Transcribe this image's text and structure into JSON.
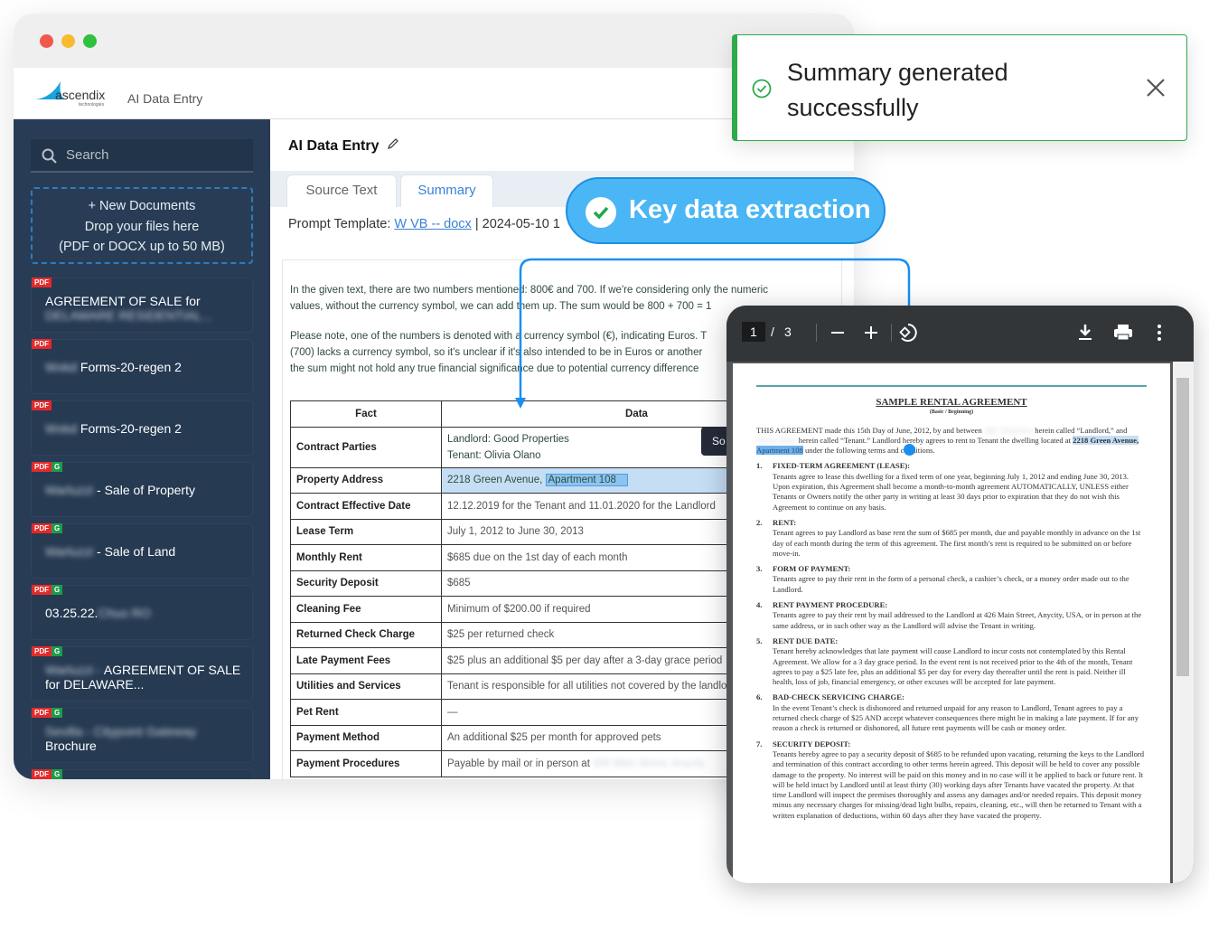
{
  "app": {
    "logo_text": "ascendix",
    "logo_sub": "technologies",
    "title": "AI Data Entry"
  },
  "sidebar": {
    "search_placeholder": "Search",
    "drop": {
      "line1": "+ New Documents",
      "line2": "Drop your files here",
      "line3": "(PDF or DOCX up to 50 MB)"
    },
    "documents": [
      {
        "badges": [
          "PDF"
        ],
        "title": "AGREEMENT OF SALE for",
        "blurred": "DELAWARE RESIDENTIAL..."
      },
      {
        "badges": [
          "PDF"
        ],
        "blurred": "Wxkd",
        "title": "Forms-20-regen 2"
      },
      {
        "badges": [
          "PDF"
        ],
        "blurred": "Wxkd",
        "title": "Forms-20-regen 2"
      },
      {
        "badges": [
          "PDF",
          "G"
        ],
        "blurred": "Warluzzi",
        "title": "- Sale of Property"
      },
      {
        "badges": [
          "PDF",
          "G"
        ],
        "blurred": "Warluzzi",
        "title": "- Sale of Land"
      },
      {
        "badges": [
          "PDF",
          "G"
        ],
        "title": "03.25.22.",
        "blurred": "Chuo RO"
      },
      {
        "badges": [
          "PDF",
          "G"
        ],
        "blurred": "Warluzzi -",
        "title": "AGREEMENT OF SALE for DELAWARE..."
      },
      {
        "badges": [
          "PDF",
          "G"
        ],
        "blurred": "Sevilla - Citypoint Gateway",
        "title": "Brochure"
      },
      {
        "badges": [
          "PDF",
          "G"
        ],
        "title": ""
      }
    ]
  },
  "main": {
    "page_title": "AI Data Entry",
    "tabs": [
      {
        "label": "Source Text"
      },
      {
        "label": "Summary",
        "active": true
      }
    ],
    "prompt": {
      "label": "Prompt Template:",
      "link": "W VB -- docx",
      "sep": "|",
      "date": "2024-05-10 1"
    },
    "paragraphs": [
      "In the given text, there are two numbers mentioned: 800€ and 700. If we're considering only the numeric",
      "values, without the currency symbol, we can add them up. The sum would be 800 + 700 = 1",
      "Please note, one of the numbers is denoted with a currency symbol (€), indicating Euros. T",
      "(700) lacks a currency symbol, so it's unclear if it's also intended to be in Euros or another",
      "the sum might not hold any true financial significance due to potential currency difference"
    ],
    "table": {
      "headers": [
        "Fact",
        "Data"
      ],
      "rows": [
        {
          "fact": "Contract Parties",
          "data": [
            "Landlord: Good Properties",
            "Tenant: Olivia Olano"
          ]
        },
        {
          "fact": "Property Address",
          "data": [
            "2218 Green Avenue,",
            "Apartment 108"
          ],
          "highlighted": true
        },
        {
          "fact": "Contract Effective Date",
          "data": [
            "12.12.2019 for the Tenant and 11.01.2020 for the Landlord"
          ]
        },
        {
          "fact": "Lease Term",
          "data": [
            "July 1, 2012 to June 30, 2013"
          ]
        },
        {
          "fact": "Monthly Rent",
          "data": [
            "$685 due on the 1st day of each month"
          ]
        },
        {
          "fact": "Security Deposit",
          "data": [
            "$685"
          ]
        },
        {
          "fact": "Cleaning Fee",
          "data": [
            "Minimum of $200.00 if required"
          ]
        },
        {
          "fact": "Returned Check Charge",
          "data": [
            "$25 per returned check"
          ]
        },
        {
          "fact": "Late Payment Fees",
          "data": [
            "$25 plus an additional $5 per day after a 3-day grace period"
          ]
        },
        {
          "fact": "Utilities and Services",
          "data": [
            "Tenant is responsible for all utilities not covered by the landlord"
          ]
        },
        {
          "fact": "Pet Rent",
          "data": [
            "—"
          ]
        },
        {
          "fact": "Payment Method",
          "data": [
            "An additional $25 per month for approved pets"
          ]
        },
        {
          "fact": "Payment Procedures",
          "data": [
            "Payable by mail or in person at",
            "426 Main Street, Anycity"
          ]
        }
      ]
    },
    "tooltip": "So"
  },
  "toast": {
    "message": "Summary generated successfully",
    "icon": "check-circle-icon",
    "color": "#2eaa4a"
  },
  "callout": {
    "label": "Key data extraction",
    "color": "#4bb6f5"
  },
  "pdf": {
    "page_current": "1",
    "page_sep": "/",
    "page_total": "3",
    "title": "SAMPLE RENTAL AGREEMENT",
    "subtitle": "(Basic / Beginning)",
    "intro": [
      "THIS AGREEMENT made this 15th Day of June, 2012, by and between",
      "ABC Properties",
      "herein called “Landlord,” and",
      "Olivia Olano",
      "herein called “Tenant.” Landlord hereby agrees to rent to Tenant the dwelling located at",
      "2218 Green Avenue,",
      "Apartment 108",
      "under the following terms and conditions."
    ],
    "sections": [
      {
        "num": "1.",
        "title": "FIXED-TERM AGREEMENT (LEASE):",
        "body": "Tenants agree to lease this dwelling for a fixed term of one year, beginning July 1, 2012 and ending June 30, 2013. Upon expiration, this Agreement shall become a month-to-month agreement AUTOMATICALLY, UNLESS either Tenants or Owners notify the other party in writing at least 30 days prior to expiration that they do not wish this Agreement to continue on any basis."
      },
      {
        "num": "2.",
        "title": "RENT:",
        "body": "Tenant agrees to pay Landlord as base rent the sum of $685 per month, due and payable monthly in advance on the 1st day of each month during the term of this agreement. The first month’s rent is required to be submitted on or before move-in."
      },
      {
        "num": "3.",
        "title": "FORM OF PAYMENT:",
        "body": "Tenants agree to pay their rent in the form of a personal check, a cashier’s check, or a money order made out to the Landlord."
      },
      {
        "num": "4.",
        "title": "RENT PAYMENT PROCEDURE:",
        "body": "Tenants agree to pay their rent by mail addressed to the Landlord at 426 Main Street, Anycity, USA, or in person at the same address, or in such other way as the Landlord will advise the Tenant in writing."
      },
      {
        "num": "5.",
        "title": "RENT DUE DATE:",
        "body": "Tenant hereby acknowledges that late payment will cause Landlord to incur costs not contemplated by this Rental Agreement. We allow for a 3 day grace period. In the event rent is not received prior to the 4th of the month, Tenant agrees to pay a $25 late fee, plus an additional $5 per day for every day thereafter until the rent is paid. Neither ill health, loss of job, financial emergency, or other excuses will be accepted for late payment."
      },
      {
        "num": "6.",
        "title": "BAD-CHECK SERVICING CHARGE:",
        "body": "In the event Tenant’s check is dishonored and returned unpaid for any reason to Landlord, Tenant agrees to pay a returned check charge of $25 AND accept whatever consequences there might be in making a late payment. If for any reason a check is returned or dishonored, all future rent payments will be cash or money order."
      },
      {
        "num": "7.",
        "title": "SECURITY DEPOSIT:",
        "body": "Tenants hereby agree to pay a security deposit of $685 to be refunded upon vacating, returning the keys to the Landlord and termination of this contract according to other terms herein agreed. This deposit will be held to cover any possible damage to the property. No interest will be paid on this money and in no case will it be applied to back or future rent. It will be held intact by Landlord until at least thirty (30) working days after Tenants have vacated the property. At that time Landlord will inspect the premises thoroughly and assess any damages and/or needed repairs. This deposit money minus any necessary charges for missing/dead light bulbs, repairs, cleaning, etc., will then be returned to Tenant with a written explanation of deductions, within 60 days after they have vacated the property."
      }
    ]
  },
  "colors": {
    "sidebar": "#283d55",
    "accent": "#3b82d6",
    "connector": "#1a8ff0",
    "highlight": "#c5def5"
  }
}
